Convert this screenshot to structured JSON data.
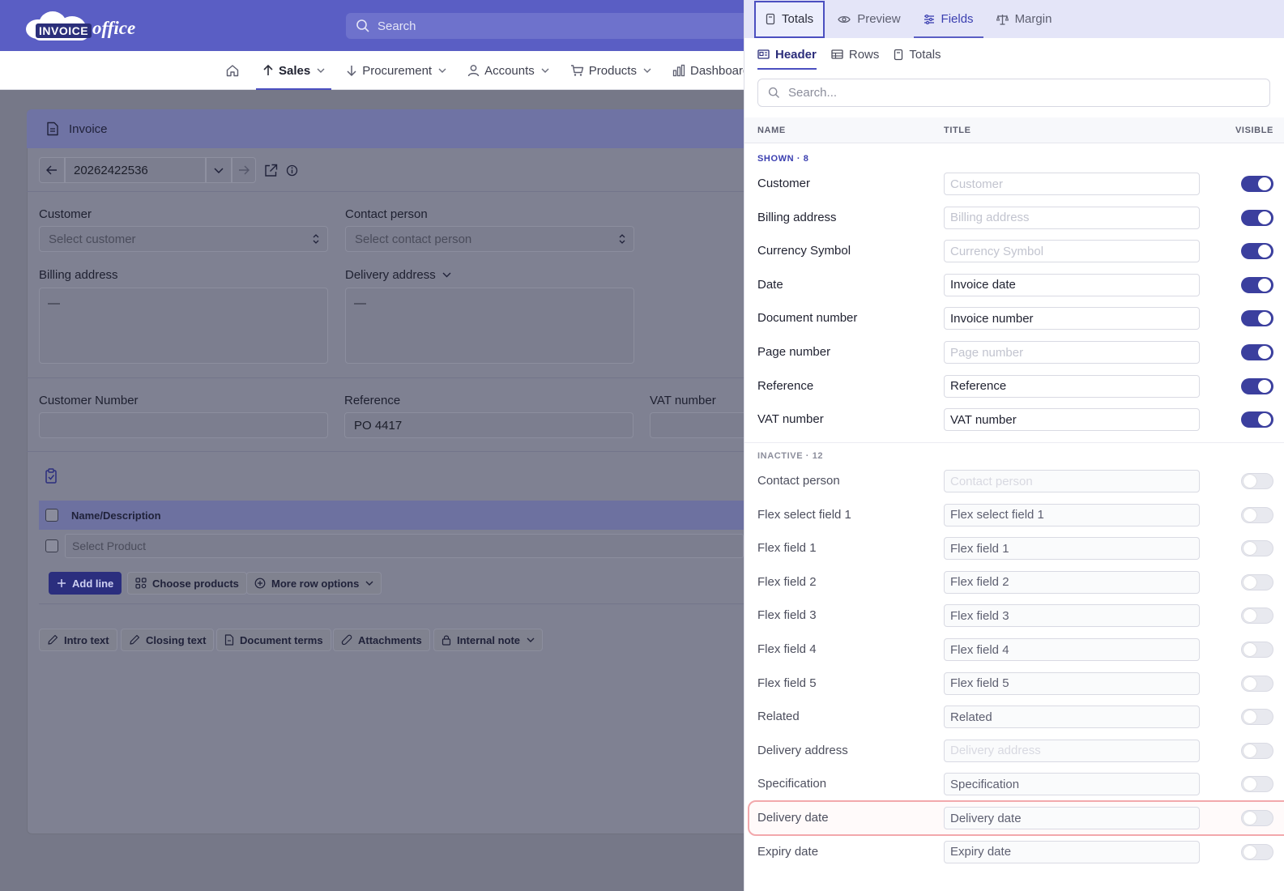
{
  "header": {
    "logo_word": "INVOICE",
    "logo_office": "office",
    "search_placeholder": "Search"
  },
  "nav": {
    "items": [
      {
        "label": "Sales",
        "icon": "arrow-up-icon",
        "active": true
      },
      {
        "label": "Procurement",
        "icon": "arrow-down-icon"
      },
      {
        "label": "Accounts",
        "icon": "user-icon"
      },
      {
        "label": "Products",
        "icon": "cart-icon"
      },
      {
        "label": "Dashboards",
        "icon": "bar-chart-icon"
      }
    ]
  },
  "invoice": {
    "title": "Invoice",
    "document_number": "20262422536",
    "customer_label": "Customer",
    "customer_placeholder": "Select customer",
    "contact_label": "Contact person",
    "contact_placeholder": "Select contact person",
    "billing_label": "Billing address",
    "billing_value": "—",
    "delivery_label": "Delivery address",
    "delivery_value": "—",
    "customer_number_label": "Customer Number",
    "customer_number_value": "",
    "reference_label": "Reference",
    "reference_value": "PO 4417",
    "vat_label": "VAT number",
    "vat_value": "",
    "table_header": "Name/Description",
    "product_placeholder": "Select Product",
    "add_line": "Add line",
    "choose_products": "Choose products",
    "more_row_options": "More row options",
    "footer_buttons": [
      "Intro text",
      "Closing text",
      "Document terms",
      "Attachments",
      "Internal note"
    ]
  },
  "panel": {
    "tabs": [
      {
        "label": "Totals",
        "icon": "document-icon",
        "selected": true
      },
      {
        "label": "Preview",
        "icon": "eye-icon"
      },
      {
        "label": "Fields",
        "icon": "sliders-icon",
        "active": true
      },
      {
        "label": "Margin",
        "icon": "scale-icon"
      }
    ],
    "subtabs": [
      {
        "label": "Header",
        "icon": "id-card-icon",
        "active": true
      },
      {
        "label": "Rows",
        "icon": "table-icon"
      },
      {
        "label": "Totals",
        "icon": "calculator-icon"
      }
    ],
    "search_placeholder": "Search...",
    "columns": {
      "name": "NAME",
      "title": "TITLE",
      "visible": "VISIBLE"
    },
    "shown_label": "SHOWN · 8",
    "inactive_label": "INACTIVE · 12",
    "shown": [
      {
        "name": "Customer",
        "value": "",
        "placeholder": "Customer"
      },
      {
        "name": "Billing address",
        "value": "",
        "placeholder": "Billing address"
      },
      {
        "name": "Currency Symbol",
        "value": "",
        "placeholder": "Currency Symbol"
      },
      {
        "name": "Date",
        "value": "Invoice date",
        "placeholder": "Date"
      },
      {
        "name": "Document number",
        "value": "Invoice number",
        "placeholder": "Document number"
      },
      {
        "name": "Page number",
        "value": "",
        "placeholder": "Page number"
      },
      {
        "name": "Reference",
        "value": "Reference",
        "placeholder": "Reference"
      },
      {
        "name": "VAT number",
        "value": "VAT number",
        "placeholder": "VAT number"
      }
    ],
    "inactive": [
      {
        "name": "Contact person",
        "value": "",
        "placeholder": "Contact person"
      },
      {
        "name": "Flex select field 1",
        "value": "Flex select field 1",
        "placeholder": ""
      },
      {
        "name": "Flex field 1",
        "value": "Flex field 1",
        "placeholder": ""
      },
      {
        "name": "Flex field 2",
        "value": "Flex field 2",
        "placeholder": ""
      },
      {
        "name": "Flex field 3",
        "value": "Flex field 3",
        "placeholder": ""
      },
      {
        "name": "Flex field 4",
        "value": "Flex field 4",
        "placeholder": ""
      },
      {
        "name": "Flex field 5",
        "value": "Flex field 5",
        "placeholder": ""
      },
      {
        "name": "Related",
        "value": "Related",
        "placeholder": ""
      },
      {
        "name": "Delivery address",
        "value": "",
        "placeholder": "Delivery address"
      },
      {
        "name": "Specification",
        "value": "Specification",
        "placeholder": ""
      },
      {
        "name": "Delivery date",
        "value": "Delivery date",
        "placeholder": ""
      },
      {
        "name": "Expiry date",
        "value": "Expiry date",
        "placeholder": ""
      }
    ]
  },
  "colors": {
    "brand": "#5a5ec4",
    "toggle_on": "#3b3f9e",
    "highlight": "#f2a8ac"
  }
}
